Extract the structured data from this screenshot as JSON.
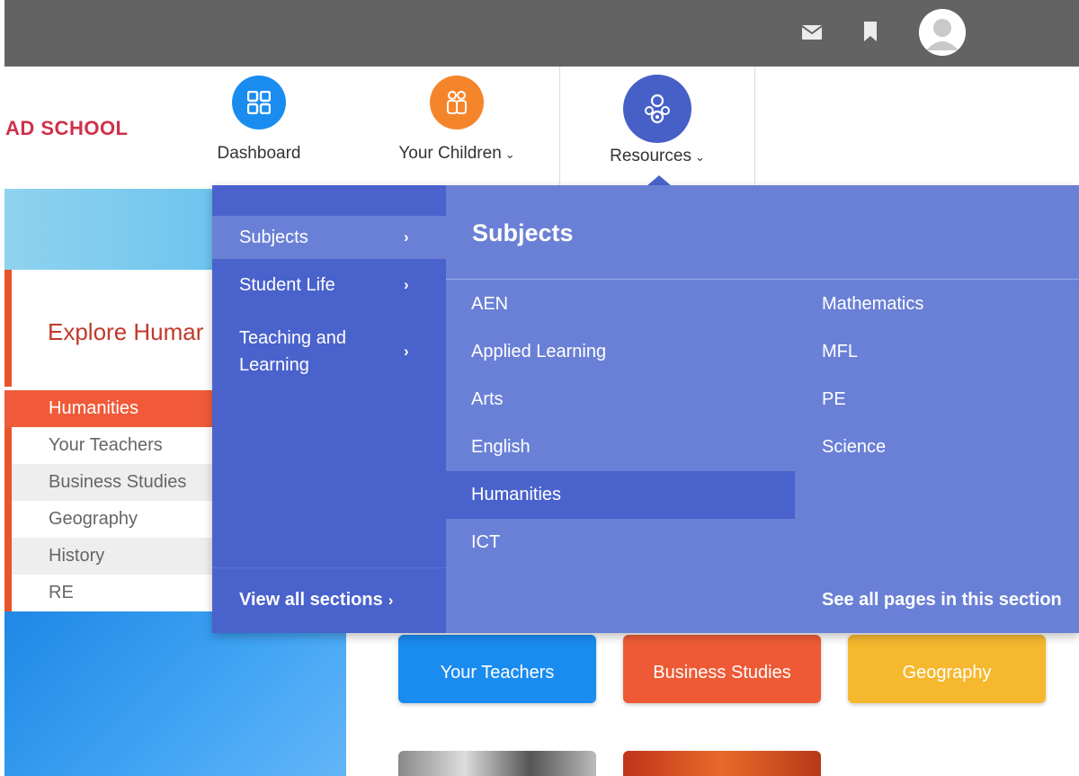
{
  "school": {
    "name": "AD SCHOOL"
  },
  "topbar": {
    "icons": [
      "mail-icon",
      "bookmark-icon",
      "avatar"
    ]
  },
  "nav": {
    "items": [
      {
        "label": "Dashboard",
        "icon": "dashboard-grid-icon",
        "color": "#1a8cf0"
      },
      {
        "label": "Your Children",
        "icon": "children-icon",
        "color": "#f5852b",
        "dropdown": true
      },
      {
        "label": "Resources",
        "icon": "resources-icon",
        "color": "#4660c8",
        "dropdown": true
      }
    ]
  },
  "page": {
    "explore_title": "Explore Humar",
    "side_list": [
      "Humanities",
      "Your Teachers",
      "Business Studies",
      "Geography",
      "History",
      "RE"
    ],
    "tiles": [
      "Your Teachers",
      "Business Studies",
      "Geography"
    ]
  },
  "mega_menu": {
    "sections": [
      "Subjects",
      "Student Life",
      "Teaching and Learning"
    ],
    "view_all": "View all sections",
    "title": "Subjects",
    "subjects_col1": [
      "AEN",
      "Applied Learning",
      "Arts",
      "English",
      "Humanities",
      "ICT"
    ],
    "subjects_col2": [
      "Mathematics",
      "MFL",
      "PE",
      "Science"
    ],
    "active_subject": "Humanities",
    "see_all": "See all pages in this section"
  },
  "colors": {
    "topbar": "#636363",
    "menu_dark": "#4a62cc",
    "menu_light": "#6a80d6",
    "accent_red": "#d0304a",
    "accent_orange": "#f05a38"
  }
}
